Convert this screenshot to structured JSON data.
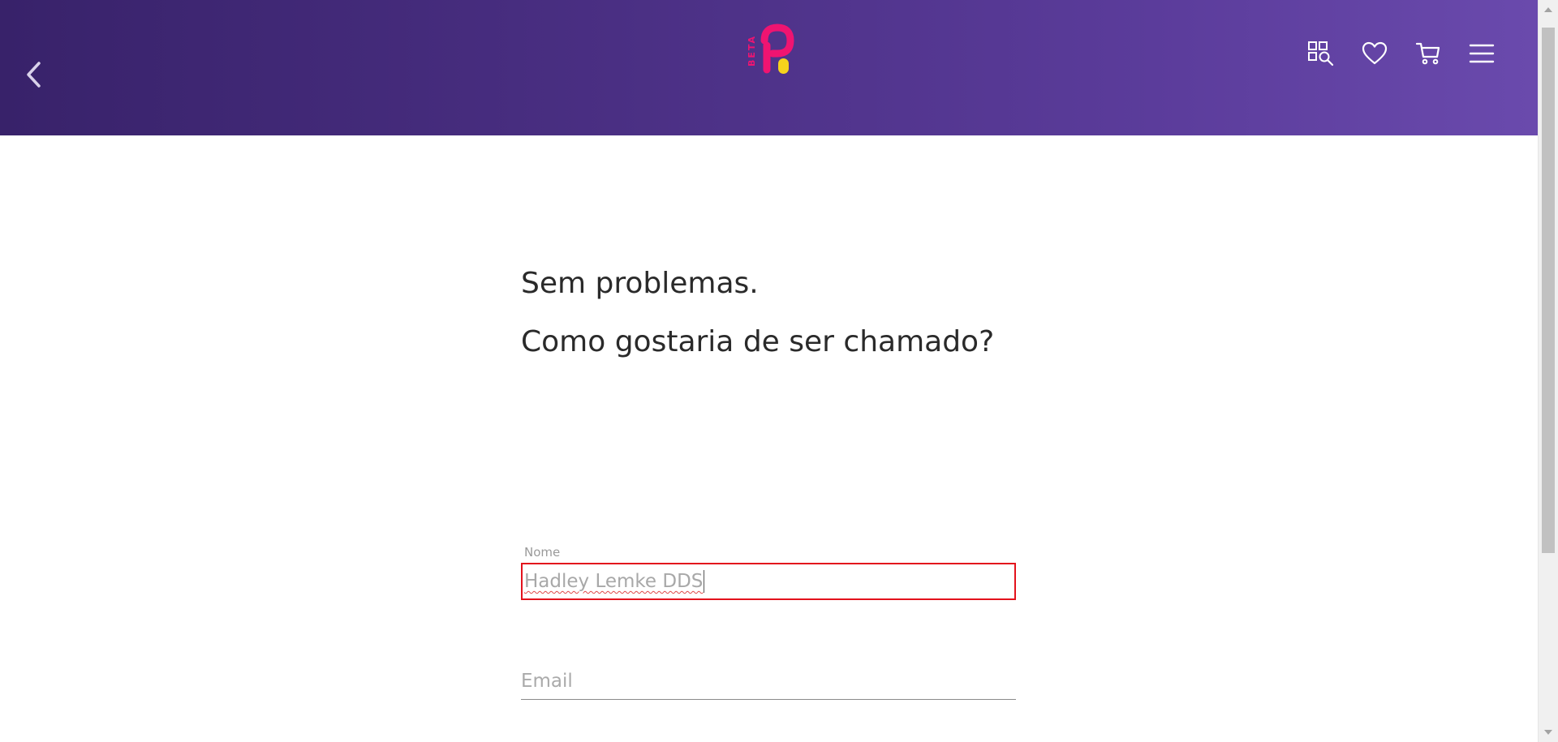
{
  "header": {
    "logo_text": "BETA",
    "colors": {
      "gradient_start": "#38226a",
      "gradient_end": "#6a4aad",
      "logo_pink": "#ef1471",
      "logo_yellow": "#f6d31d"
    },
    "icons": [
      "back-arrow-icon",
      "category-search-icon",
      "heart-icon",
      "cart-icon",
      "menu-icon"
    ]
  },
  "main": {
    "line1": "Sem problemas.",
    "line2": "Como gostaria de ser chamado?",
    "name_field": {
      "label": "Nome",
      "value": "Hadley Lemke DDS"
    },
    "email_field": {
      "placeholder": "Email"
    }
  },
  "colors": {
    "focus_border": "#e3121c"
  }
}
